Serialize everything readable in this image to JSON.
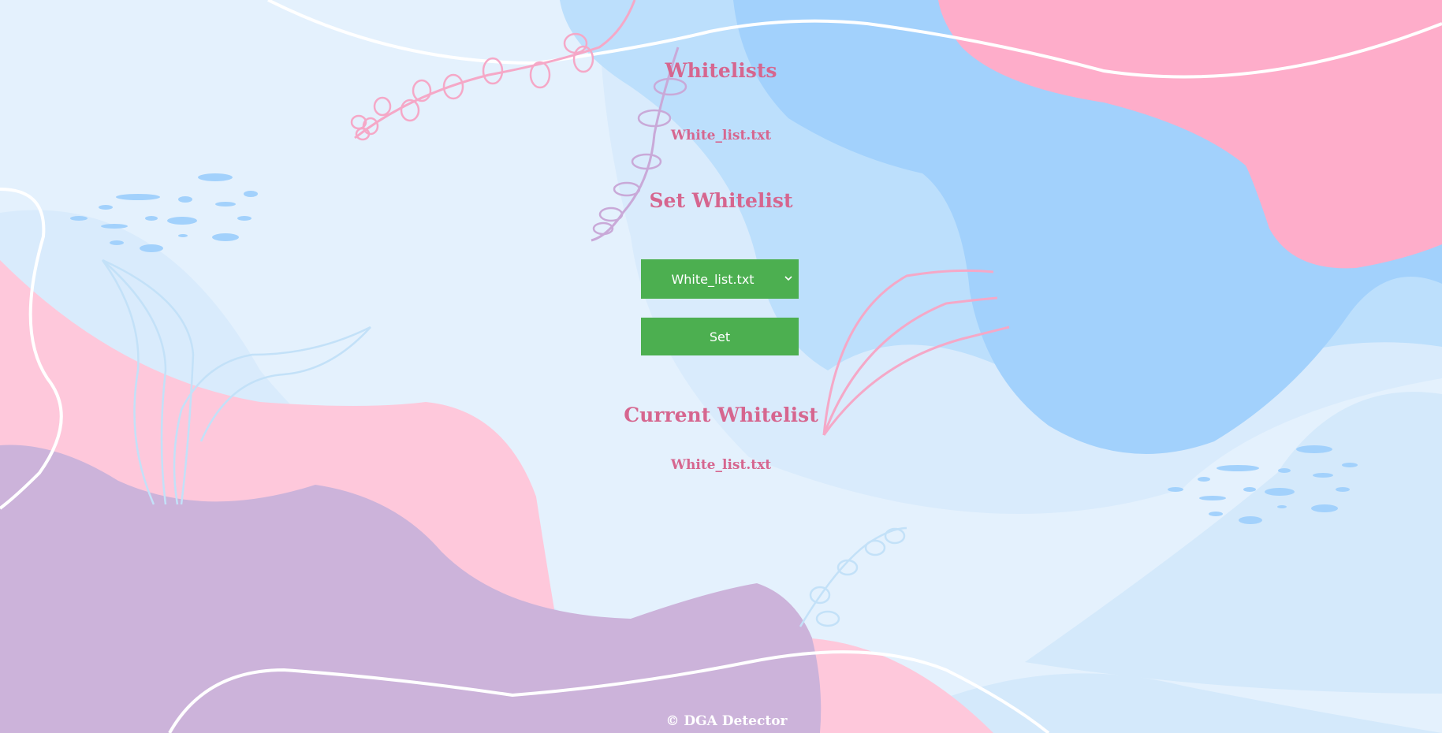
{
  "page": {
    "title": "Whitelists",
    "whitelist_file": "White_list.txt"
  },
  "set_section": {
    "title": "Set Whitelist",
    "select": {
      "selected": "White_list.txt",
      "options": [
        "White_list.txt"
      ]
    },
    "set_button_label": "Set"
  },
  "current_section": {
    "title": "Current Whitelist",
    "value": "White_list.txt"
  },
  "footer": {
    "text": "© DGA Detector"
  },
  "colors": {
    "heading": "#d6668f",
    "button": "#4caf50",
    "background": "#e4f1fd",
    "blob_pink": "#fec8db",
    "blob_hotpink": "#feadca",
    "blob_purple": "#ccb3da",
    "blob_blue": "#a2d1fc",
    "blob_lightblue": "#bcdffc"
  },
  "icons": {
    "select_arrow": "chevron-down-icon"
  }
}
